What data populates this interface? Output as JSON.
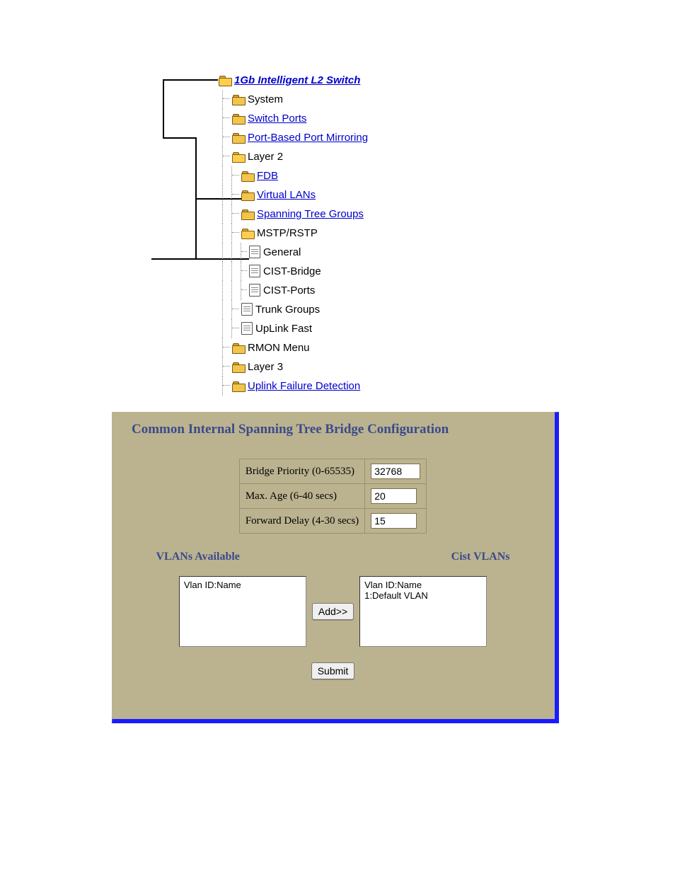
{
  "tree": {
    "root": "1Gb Intelligent L2 Switch",
    "items": {
      "system": "System",
      "switch_ports": "Switch Ports",
      "mirroring": "Port-Based Port Mirroring",
      "layer2": "Layer 2",
      "fdb": "FDB",
      "vlans": "Virtual LANs",
      "stg": "Spanning Tree Groups",
      "mstp": "MSTP/RSTP",
      "general": "General",
      "cist_bridge": "CIST-Bridge",
      "cist_ports": "CIST-Ports",
      "trunk": "Trunk Groups",
      "uplinkfast": "UpLink Fast",
      "rmon": "RMON Menu",
      "layer3": "Layer 3",
      "ufd": "Uplink Failure Detection"
    }
  },
  "panel": {
    "title": "Common Internal Spanning Tree Bridge Configuration",
    "rows": [
      {
        "label": "Bridge Priority (0-65535)",
        "value": "32768"
      },
      {
        "label": "Max. Age (6-40 secs)",
        "value": "20"
      },
      {
        "label": "Forward Delay (4-30 secs)",
        "value": "15"
      }
    ],
    "headings": {
      "left": "VLANs Available",
      "right": "Cist VLANs"
    },
    "lists": {
      "available_header": "Vlan ID:Name",
      "available_text": "Vlan ID:Name",
      "cist_text": "Vlan ID:Name\n1:Default VLAN"
    },
    "buttons": {
      "add": "Add>>",
      "submit": "Submit"
    }
  }
}
